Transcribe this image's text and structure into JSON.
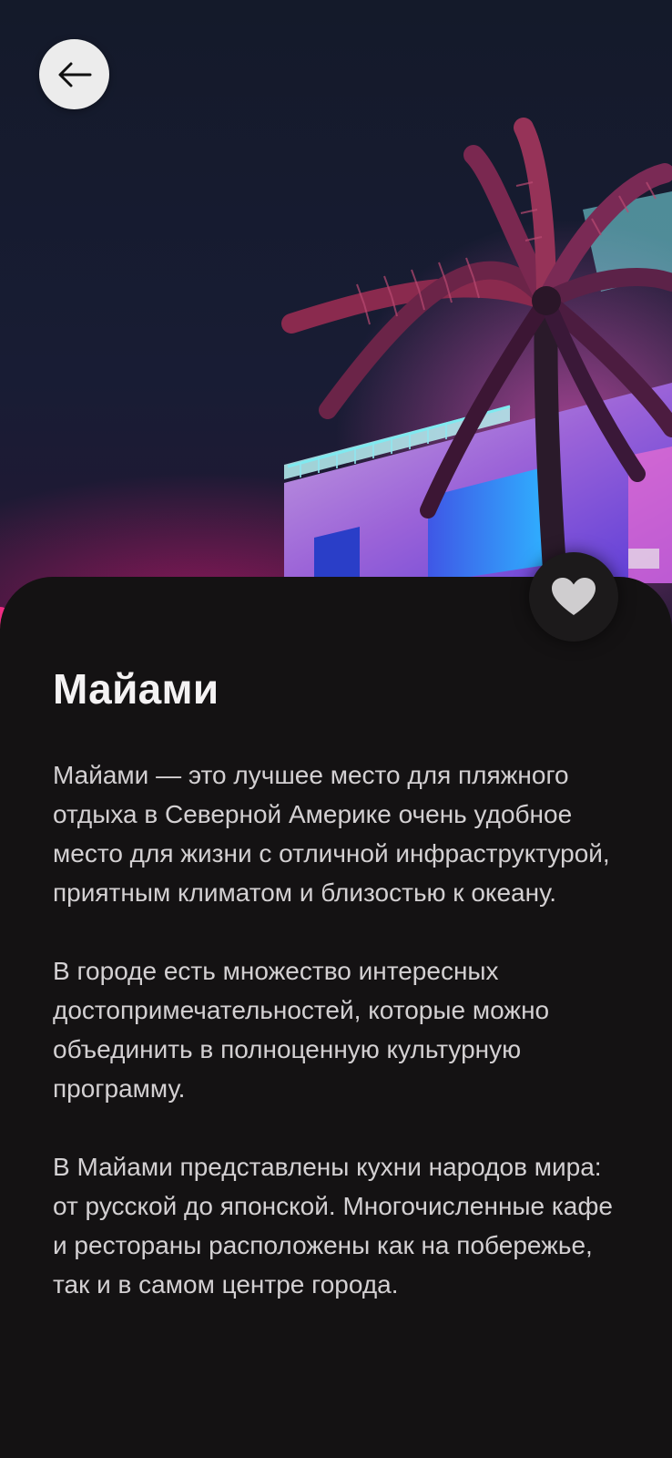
{
  "back_icon": "arrow-left-icon",
  "favorite_icon": "heart-icon",
  "city": {
    "title": "Майами",
    "paragraphs": [
      "Майами — это лучшее место для пляж­ного отдыха в Северной Америке очень удобное место для жизни с отличной инфраструктурой, приятным климатом и близостью к океану.",
      "В городе есть множество интересных достопримечательностей, которые можно объединить в полноценную куль­турную программу.",
      "В Майами представлены кухни народов мира: от русской до японской. Много­численные кафе и рестораны располо­жены как на побережье, так и в самом центре города."
    ]
  },
  "colors": {
    "background": "#141213",
    "title": "#f4f2f3",
    "text": "#d3d0d2",
    "sky": "#171c2e",
    "neon_pink": "#e8187a",
    "neon_blue": "#3a6cf0",
    "neon_cyan": "#4fd8e8"
  }
}
